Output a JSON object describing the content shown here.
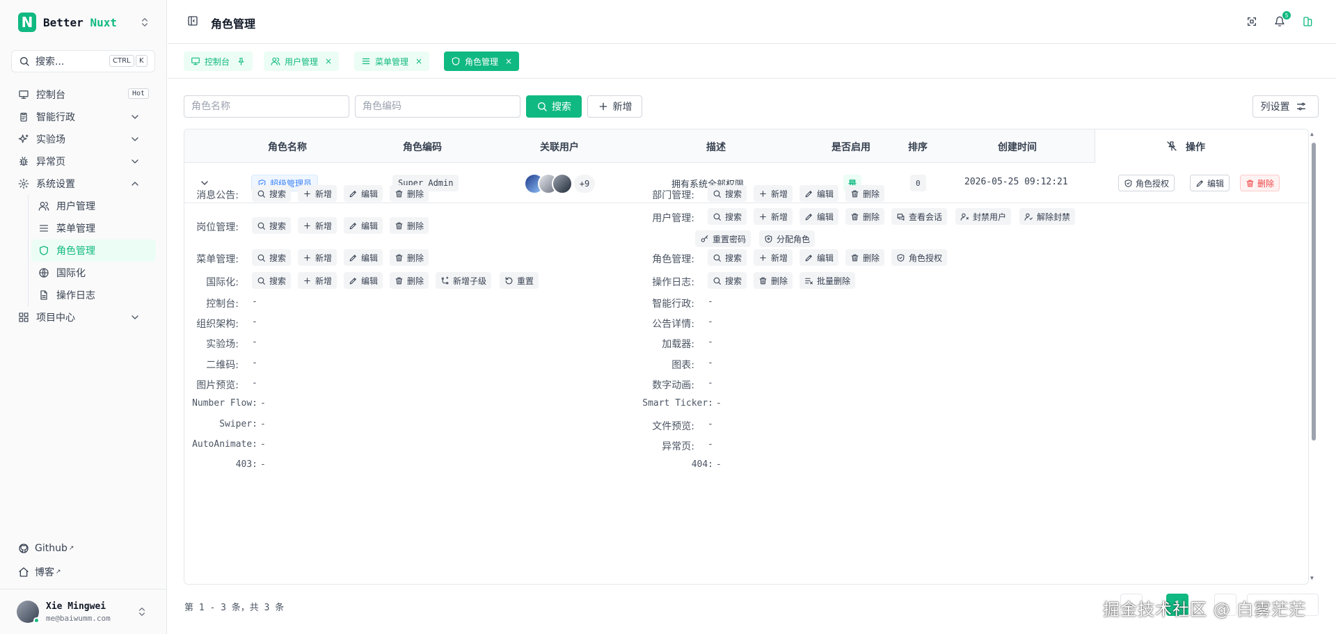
{
  "brand": {
    "name": "Better",
    "accent": "Nuxt",
    "color": "#10b981"
  },
  "search": {
    "label": "搜索...",
    "kbd1": "CTRL",
    "kbd2": "K"
  },
  "sidebar": {
    "items": [
      {
        "label": "控制台",
        "icon": "monitor-icon",
        "badge": "Hot"
      },
      {
        "label": "智能行政",
        "icon": "clipboard-icon"
      },
      {
        "label": "实验场",
        "icon": "sparkles-icon"
      },
      {
        "label": "异常页",
        "icon": "bug-icon"
      },
      {
        "label": "系统设置",
        "icon": "gear-icon"
      }
    ],
    "sub": [
      {
        "label": "用户管理",
        "icon": "users-icon"
      },
      {
        "label": "菜单管理",
        "icon": "menu-icon"
      },
      {
        "label": "角色管理",
        "icon": "shield-icon"
      },
      {
        "label": "国际化",
        "icon": "globe-icon"
      },
      {
        "label": "操作日志",
        "icon": "file-text-icon"
      }
    ],
    "project": {
      "label": "项目中心",
      "icon": "grid-icon"
    },
    "github": "Github",
    "blog": "博客",
    "user": {
      "name": "Xie Mingwei",
      "email": "me@baiwumm.com"
    }
  },
  "header": {
    "title": "角色管理",
    "badge": "5"
  },
  "tabs": [
    {
      "label": "控制台",
      "close": "📌"
    },
    {
      "label": "用户管理",
      "close": "×"
    },
    {
      "label": "菜单管理",
      "close": "×"
    },
    {
      "label": "角色管理",
      "close": "×"
    }
  ],
  "toolbar": {
    "name_placeholder": "角色名称",
    "code_placeholder": "角色编码",
    "search": "搜索",
    "add": "新增",
    "columns": "列设置"
  },
  "table": {
    "headers": [
      "角色名称",
      "角色编码",
      "关联用户",
      "描述",
      "是否启用",
      "排序",
      "创建时间",
      "操作"
    ],
    "row": {
      "name": "超级管理员",
      "code": "Super Admin",
      "more_users": "+9",
      "desc": "拥有系统全部权限",
      "enabled": "是",
      "sort": "0",
      "created": "2026-05-25 09:12:21",
      "ops": [
        "角色授权",
        "编辑",
        "删除"
      ]
    }
  },
  "perms": {
    "left": [
      {
        "label": "消息公告:",
        "actions": [
          "搜索",
          "新增",
          "编辑",
          "删除"
        ]
      },
      {
        "label": "岗位管理:",
        "actions": [
          "搜索",
          "新增",
          "编辑",
          "删除"
        ]
      },
      {
        "label": "菜单管理:",
        "actions": [
          "搜索",
          "新增",
          "编辑",
          "删除"
        ]
      },
      {
        "label": "国际化:",
        "actions": [
          "搜索",
          "新增",
          "编辑",
          "删除",
          "新增子级",
          "重置"
        ]
      },
      {
        "label": "控制台:"
      },
      {
        "label": "组织架构:"
      },
      {
        "label": "实验场:"
      },
      {
        "label": "二维码:"
      },
      {
        "label": "图片预览:"
      },
      {
        "label": "Number Flow:"
      },
      {
        "label": "Swiper:"
      },
      {
        "label": "AutoAnimate:"
      },
      {
        "label": "403:"
      }
    ],
    "right": [
      {
        "label": "部门管理:",
        "actions": [
          "搜索",
          "新增",
          "编辑",
          "删除"
        ]
      },
      {
        "label": "用户管理:",
        "actions": [
          "搜索",
          "新增",
          "编辑",
          "删除",
          "查看会话",
          "封禁用户",
          "解除封禁",
          "重置密码",
          "分配角色"
        ]
      },
      {
        "label": "角色管理:",
        "actions": [
          "搜索",
          "新增",
          "编辑",
          "删除",
          "角色授权"
        ]
      },
      {
        "label": "操作日志:",
        "actions": [
          "搜索",
          "删除",
          "批量删除"
        ]
      },
      {
        "label": "智能行政:"
      },
      {
        "label": "公告详情:"
      },
      {
        "label": "加载器:"
      },
      {
        "label": "图表:"
      },
      {
        "label": "数字动画:"
      },
      {
        "label": "Smart Ticker:"
      },
      {
        "label": "文件预览:"
      },
      {
        "label": "异常页:"
      },
      {
        "label": "404:"
      }
    ],
    "empty": "-"
  },
  "pager": {
    "summary": "第 1 - 3 条，共 3 条",
    "current": "1"
  },
  "watermark": "掘金技术社区 @ 白雾茫茫"
}
